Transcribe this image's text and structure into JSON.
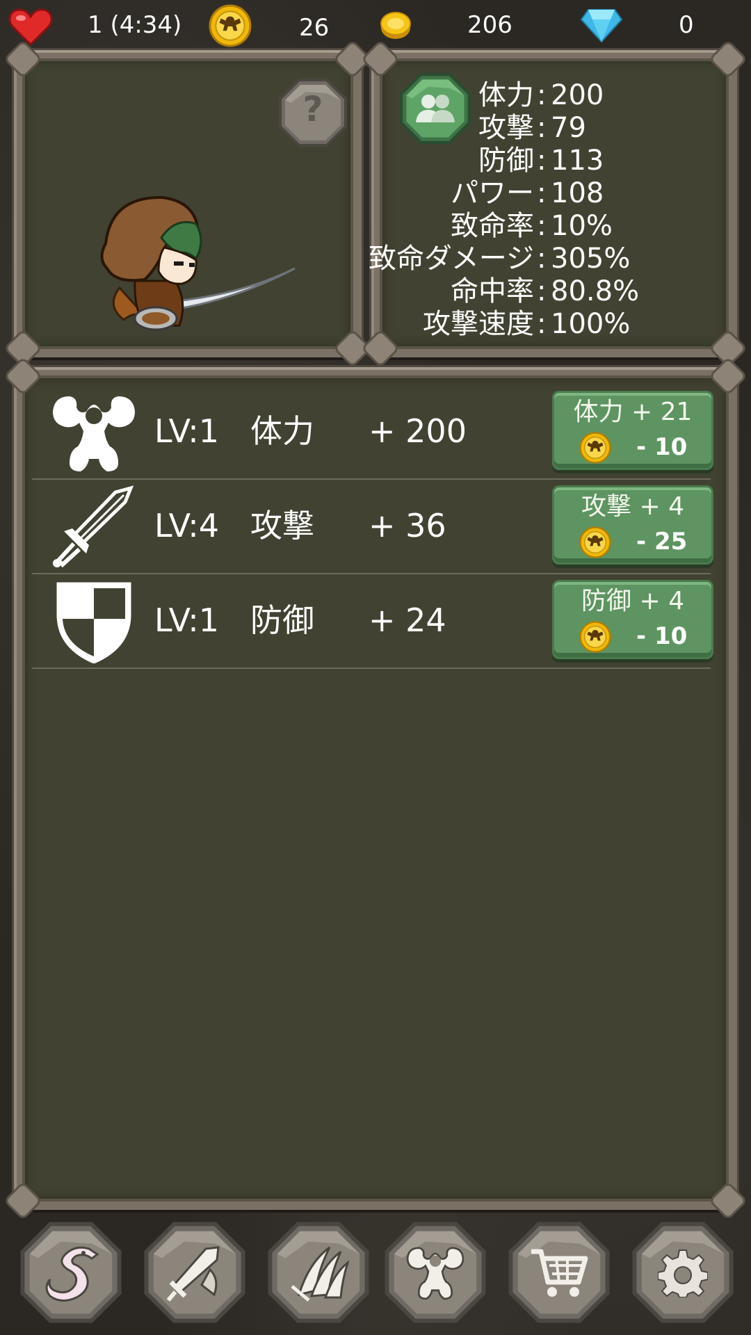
{
  "topbar": {
    "lives": "1 (4:34)",
    "medals": "26",
    "gold": "206",
    "gems": "0"
  },
  "help_button": {
    "label": "?"
  },
  "stats": [
    {
      "label": "体力",
      "value": "200"
    },
    {
      "label": "攻撃",
      "value": "79"
    },
    {
      "label": "防御",
      "value": "113"
    },
    {
      "label": "パワー",
      "value": "108"
    },
    {
      "label": "致命率",
      "value": "10%"
    },
    {
      "label": "致命ダメージ",
      "value": "305%"
    },
    {
      "label": "命中率",
      "value": "80.8%"
    },
    {
      "label": "攻撃速度",
      "value": "100%"
    }
  ],
  "stat_separator": ":",
  "upgrades": [
    {
      "icon": "muscle-icon",
      "level": "LV:1",
      "name": "体力",
      "bonus": "+ 200",
      "button_label": "体力 + 21",
      "cost": "- 10"
    },
    {
      "icon": "sword-icon",
      "level": "LV:4",
      "name": "攻撃",
      "bonus": "+ 36",
      "button_label": "攻撃 + 4",
      "cost": "- 25"
    },
    {
      "icon": "shield-icon",
      "level": "LV:1",
      "name": "防御",
      "bonus": "+ 24",
      "button_label": "防御 + 4",
      "cost": "- 10"
    }
  ],
  "nav": [
    {
      "icon": "dragon-icon"
    },
    {
      "icon": "weapons-icon"
    },
    {
      "icon": "claw-icon"
    },
    {
      "icon": "muscle-icon"
    },
    {
      "icon": "cart-icon"
    },
    {
      "icon": "gear-icon"
    }
  ],
  "colors": {
    "panel": "#414231",
    "stone": "#7b7265",
    "button_green": "#5e9461",
    "coin_yellow": "#f5c518",
    "gem_blue": "#5fd0f0",
    "heart_red": "#e02a2a"
  }
}
